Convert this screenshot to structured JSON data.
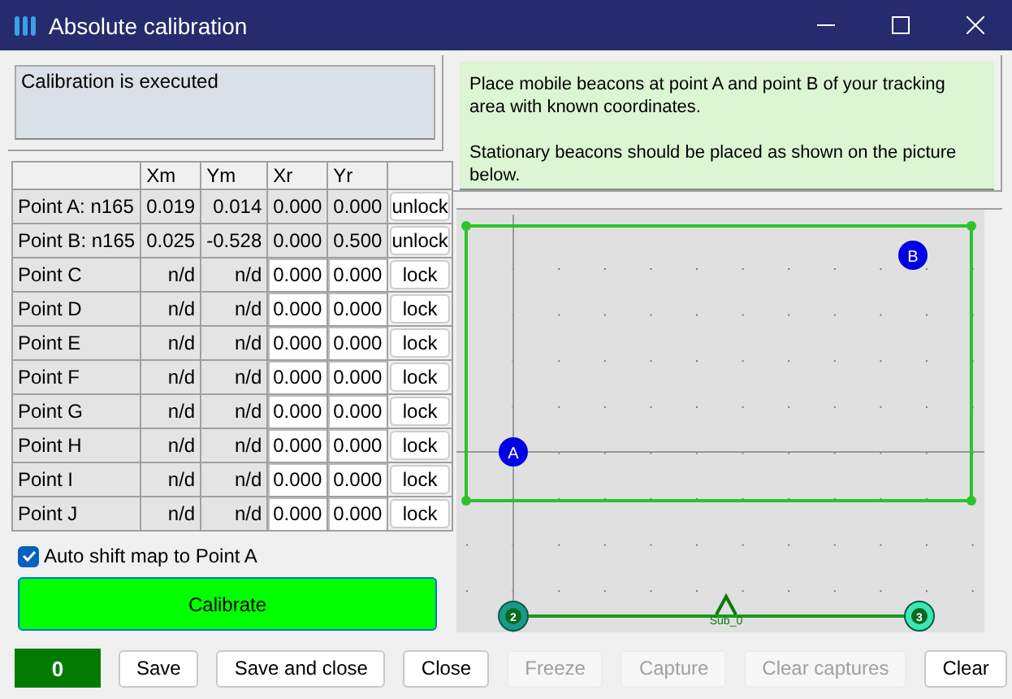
{
  "window": {
    "title": "Absolute calibration"
  },
  "status_message": "Calibration is executed",
  "table": {
    "columns": [
      "Xm",
      "Ym",
      "Xr",
      "Yr"
    ],
    "rows": [
      {
        "point": "Point A: n165",
        "xm": "0.019",
        "ym": "0.014",
        "xr": "0.000",
        "yr": "0.000",
        "action": "unlock",
        "editable": false
      },
      {
        "point": "Point B: n165",
        "xm": "0.025",
        "ym": "-0.528",
        "xr": "0.000",
        "yr": "0.500",
        "action": "unlock",
        "editable": false
      },
      {
        "point": "Point C",
        "xm": "n/d",
        "ym": "n/d",
        "xr": "0.000",
        "yr": "0.000",
        "action": "lock",
        "editable": true
      },
      {
        "point": "Point D",
        "xm": "n/d",
        "ym": "n/d",
        "xr": "0.000",
        "yr": "0.000",
        "action": "lock",
        "editable": true
      },
      {
        "point": "Point E",
        "xm": "n/d",
        "ym": "n/d",
        "xr": "0.000",
        "yr": "0.000",
        "action": "lock",
        "editable": true
      },
      {
        "point": "Point F",
        "xm": "n/d",
        "ym": "n/d",
        "xr": "0.000",
        "yr": "0.000",
        "action": "lock",
        "editable": true
      },
      {
        "point": "Point G",
        "xm": "n/d",
        "ym": "n/d",
        "xr": "0.000",
        "yr": "0.000",
        "action": "lock",
        "editable": true
      },
      {
        "point": "Point H",
        "xm": "n/d",
        "ym": "n/d",
        "xr": "0.000",
        "yr": "0.000",
        "action": "lock",
        "editable": true
      },
      {
        "point": "Point I",
        "xm": "n/d",
        "ym": "n/d",
        "xr": "0.000",
        "yr": "0.000",
        "action": "lock",
        "editable": true
      },
      {
        "point": "Point J",
        "xm": "n/d",
        "ym": "n/d",
        "xr": "0.000",
        "yr": "0.000",
        "action": "lock",
        "editable": true
      }
    ]
  },
  "auto_shift": {
    "label": "Auto shift map to Point A",
    "checked": true
  },
  "calibrate_button": "Calibrate",
  "instructions": [
    "Place mobile beacons at point A and point B of your tracking area with known coordinates.",
    "Stationary beacons should be placed as shown on the picture below."
  ],
  "map": {
    "beacons": [
      {
        "label": "A"
      },
      {
        "label": "B"
      }
    ],
    "anchors": [
      {
        "label": "2",
        "color": "#1a9a86"
      },
      {
        "label": "3",
        "color": "#3de8b0"
      }
    ],
    "sub_label": "Sub_0"
  },
  "counter": "0",
  "buttons": [
    {
      "label": "Save",
      "disabled": false
    },
    {
      "label": "Save and close",
      "disabled": false
    },
    {
      "label": "Close",
      "disabled": false
    },
    {
      "label": "Freeze",
      "disabled": true
    },
    {
      "label": "Capture",
      "disabled": true
    },
    {
      "label": "Clear captures",
      "disabled": true
    },
    {
      "label": "Clear",
      "disabled": false
    }
  ]
}
